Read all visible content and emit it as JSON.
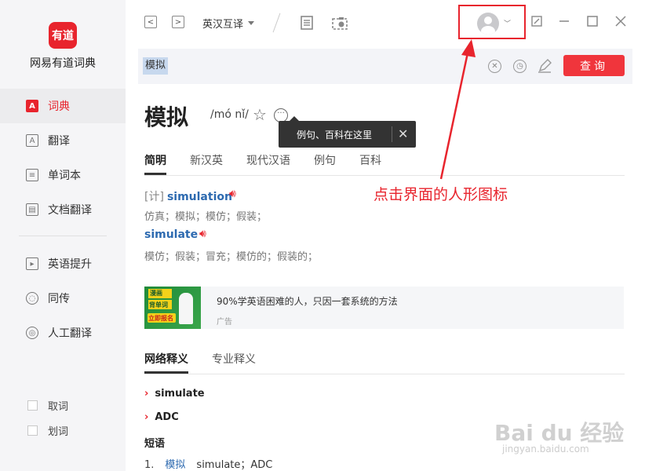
{
  "app": {
    "logo_text": "有道",
    "name": "网易有道词典"
  },
  "sidebar": {
    "items": [
      {
        "label": "词典",
        "icon": "A"
      },
      {
        "label": "翻译",
        "icon": "A"
      },
      {
        "label": "单词本",
        "icon": "≡"
      },
      {
        "label": "文档翻译",
        "icon": "▤"
      },
      {
        "label": "英语提升",
        "icon": "▸"
      },
      {
        "label": "同传",
        "icon": "◌"
      },
      {
        "label": "人工翻译",
        "icon": "◎"
      }
    ],
    "checkboxes": [
      "取词",
      "划词"
    ]
  },
  "toolbar": {
    "back": "<",
    "forward": ">",
    "direction": "英汉互译"
  },
  "search": {
    "value": "模拟",
    "query_label": "查询"
  },
  "word": {
    "headword": "模拟",
    "phonetic": "/mó nǐ/",
    "tooltip": "例句、百科在这里"
  },
  "tabs": [
    "简明",
    "新汉英",
    "现代汉语",
    "例句",
    "百科"
  ],
  "definitions": [
    {
      "tag": "[计]",
      "word": "simulation",
      "meaning": "仿真；模拟；模仿；假装；"
    },
    {
      "tag": "",
      "word": "simulate",
      "meaning": "模仿；假装；冒充；模仿的；假装的；"
    }
  ],
  "ad": {
    "image_lines": [
      "漫画",
      "背单词",
      "立即报名"
    ],
    "text": "90%学英语困难的人，只因一套系统的方法",
    "label": "广告"
  },
  "tabs2": [
    "网络释义",
    "专业释义"
  ],
  "web_items": [
    "simulate",
    "ADC"
  ],
  "phrases": {
    "title": "短语",
    "rows": [
      {
        "num": "1.",
        "word": "模拟",
        "trans": "simulate；ADC"
      }
    ]
  },
  "annotation": {
    "text": "点击界面的人形图标"
  },
  "watermark": {
    "main": "Bai du 经验",
    "sub": "jingyan.baidu.com"
  },
  "colors": {
    "accent": "#e8242d",
    "link": "#2d6ab0"
  }
}
